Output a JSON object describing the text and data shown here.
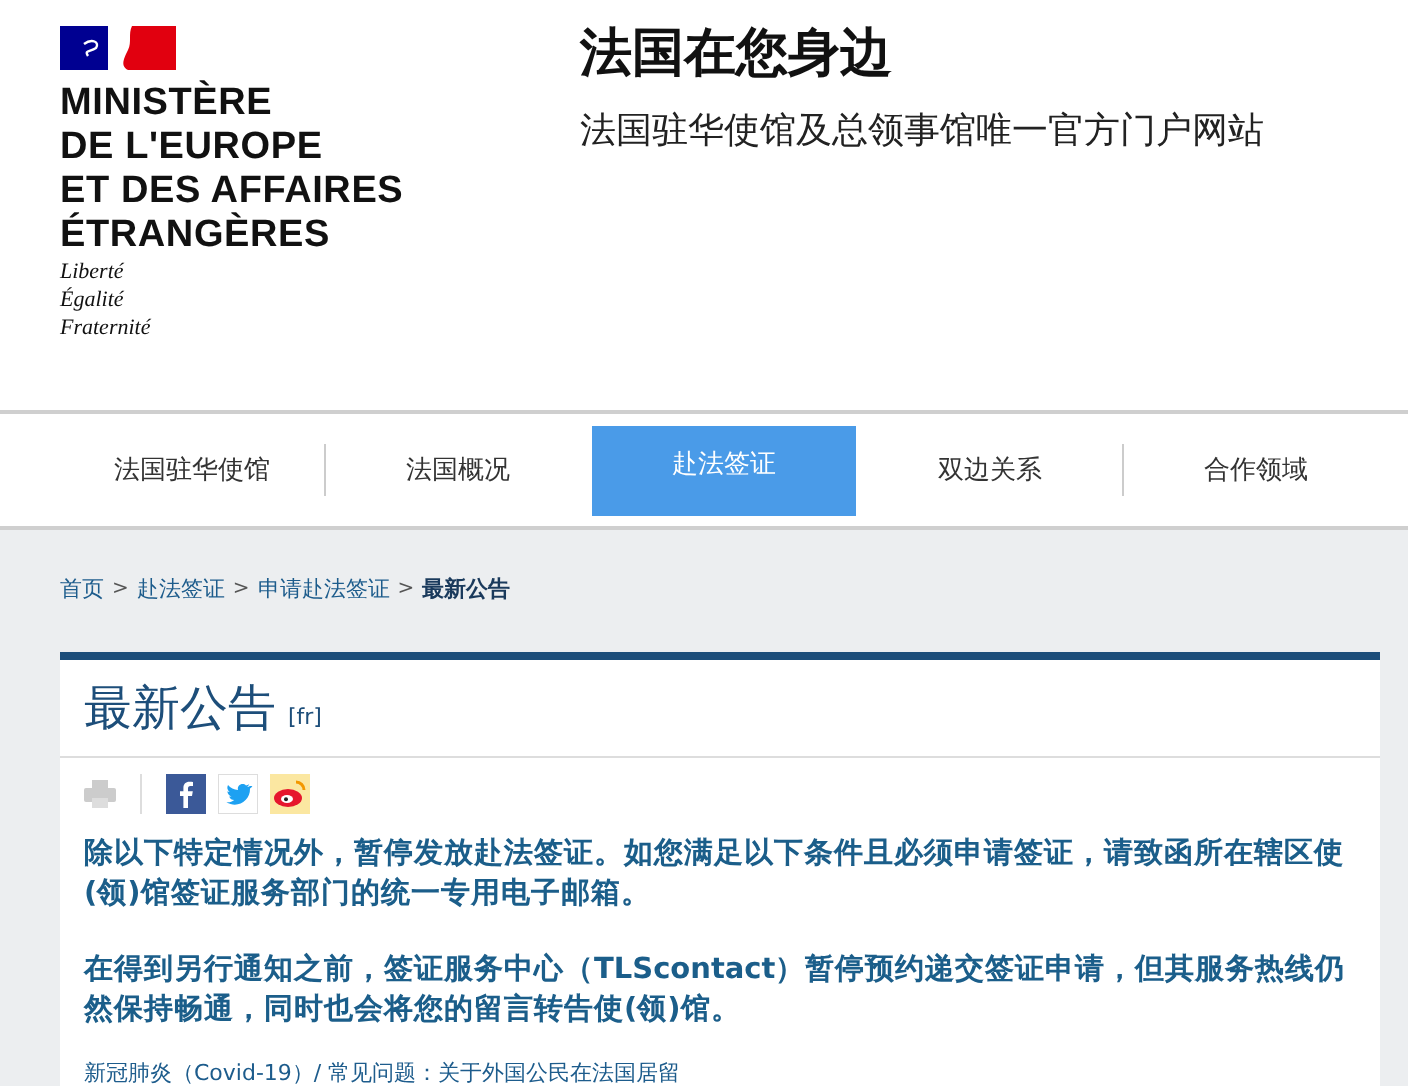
{
  "header": {
    "ministry": [
      "MINISTÈRE",
      "DE L'EUROPE",
      "ET DES AFFAIRES",
      "ÉTRANGÈRES"
    ],
    "motto": [
      "Liberté",
      "Égalité",
      "Fraternité"
    ],
    "title": "法国在您身边",
    "subtitle": "法国驻华使馆及总领事馆唯一官方门户网站"
  },
  "nav": [
    {
      "label": "法国驻华使馆",
      "selected": false
    },
    {
      "label": "法国概况",
      "selected": false
    },
    {
      "label": "赴法签证",
      "selected": true
    },
    {
      "label": "双边关系",
      "selected": false
    },
    {
      "label": "合作领域",
      "selected": false
    }
  ],
  "breadcrumb": [
    {
      "label": "首页",
      "current": false
    },
    {
      "label": "赴法签证",
      "current": false
    },
    {
      "label": "申请赴法签证",
      "current": false
    },
    {
      "label": "最新公告",
      "current": true
    }
  ],
  "breadcrumb_separator": ">",
  "article": {
    "title": "最新公告",
    "lang": "[fr]",
    "paragraphs": [
      "除以下特定情况外，暂停发放赴法签证。如您满足以下条件且必须申请签证，请致函所在辖区使(领)馆签证服务部门的统一专用电子邮箱。",
      "在得到另行通知之前，签证服务中心（TLScontact）暂停预约递交签证申请，但其服务热线仍然保持畅通，同时也会将您的留言转告使(领)馆。"
    ],
    "link": "新冠肺炎（Covid-19）/ 常见问题：关于外国公民在法国居留"
  }
}
